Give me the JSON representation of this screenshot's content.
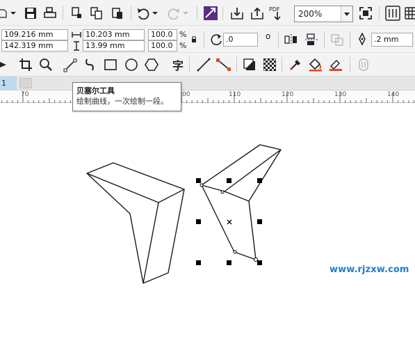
{
  "toolbar_standard": {
    "icons": [
      "open-icon",
      "save-icon",
      "print-icon",
      "import-icon",
      "export-icon",
      "copy-icon",
      "paste-icon",
      "undo-icon",
      "redo-icon",
      "corel-connect-icon",
      "import-arrow-icon",
      "export-arrow-icon",
      "export-pdf-icon",
      "fullscreen-icon",
      "options-icon",
      "grid-icon"
    ],
    "pdf_label": "PDF",
    "zoom_value": "200%"
  },
  "property_bar": {
    "x": "109.216 mm",
    "y": "142.319 mm",
    "width": "10.203 mm",
    "height": "13.99 mm",
    "scale_x": "100.0",
    "scale_y": "100.0",
    "percent": "%",
    "rotation": ".0",
    "degree": "o",
    "outline_width": ".2 mm"
  },
  "toolbox": {
    "icons": [
      "crop-icon",
      "zoom-icon",
      "bezier-tool-icon",
      "artistic-media-icon",
      "rectangle-icon",
      "ellipse-icon",
      "polygon-icon",
      "text-icon",
      "parallel-dimension-icon",
      "connector-icon",
      "drop-shadow-icon",
      "transparency-icon",
      "eyedropper-icon",
      "interactive-fill-icon",
      "smart-fill-icon",
      "lock-icon"
    ],
    "text_tool_glyph": "字",
    "active": "bezier-tool-icon"
  },
  "page_tabs": {
    "current": "1"
  },
  "ruler": {
    "ticks": [
      "70",
      "00",
      "110",
      "120",
      "130",
      "140"
    ]
  },
  "tooltip": {
    "title": "贝塞尔工具",
    "description": "绘制曲线，一次绘制一段。"
  },
  "watermark": "www.rjzxw.com",
  "colors": {
    "toolbar_bg": "#f3f3f3",
    "active_tool": "#cde3f7",
    "watermark": "#1c7fd1",
    "selection_handle": "#000000"
  }
}
